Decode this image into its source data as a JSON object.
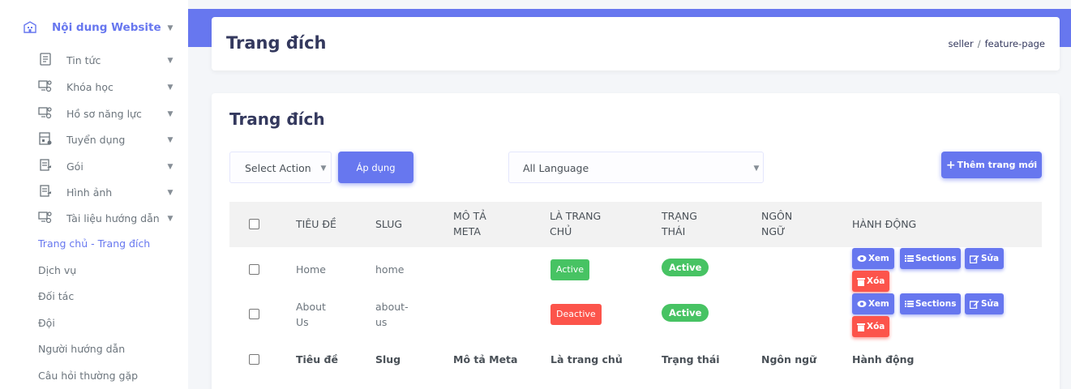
{
  "colors": {
    "primary": "#6777ef",
    "success": "#47c363",
    "danger": "#fc544b"
  },
  "sidebar": {
    "top": {
      "label": "Nội dung Website",
      "icon": "building-icon"
    },
    "items": [
      {
        "label": "Tin tức",
        "icon": "document-icon"
      },
      {
        "label": "Khóa học",
        "icon": "network-icon"
      },
      {
        "label": "Hồ sơ năng lực",
        "icon": "network-icon"
      },
      {
        "label": "Tuyển dụng",
        "icon": "store-icon"
      },
      {
        "label": "Gói",
        "icon": "clipboard-icon"
      },
      {
        "label": "Hình ảnh",
        "icon": "clipboard-icon"
      },
      {
        "label": "Tài liệu hướng dẫn",
        "icon": "network-icon"
      }
    ],
    "links": [
      {
        "label": "Trang chủ - Trang đích",
        "active": true
      },
      {
        "label": "Dịch vụ"
      },
      {
        "label": "Đối tác"
      },
      {
        "label": "Đội"
      },
      {
        "label": "Người hướng dẫn"
      },
      {
        "label": "Câu hỏi thường gặp"
      }
    ]
  },
  "header": {
    "title": "Trang đích",
    "breadcrumb": [
      "seller",
      "feature-page"
    ]
  },
  "main": {
    "title": "Trang đích",
    "select_action": "Select Action",
    "apply_label": "Áp dụng",
    "language": "All Language",
    "add_label": "Thêm trang mới",
    "columns": {
      "title": "Tiêu đề",
      "slug": "Slug",
      "meta_1": "Mô tả",
      "meta_2": "meta",
      "home_1": "Là trang",
      "home_2": "chủ",
      "status_1": "Trạng",
      "status_2": "thái",
      "lang_1": "Ngôn",
      "lang_2": "ngữ",
      "actions": "Hành động"
    },
    "rows": [
      {
        "title": "Home",
        "slug": "home",
        "home_badge": "Active",
        "status_badge": "Active"
      },
      {
        "title_1": "About",
        "title_2": "Us",
        "slug_1": "about-",
        "slug_2": "us",
        "home_badge": "Deactive",
        "status_badge": "Active"
      }
    ],
    "actions": {
      "view": "Xem",
      "sections": "Sections",
      "edit": "Sửa",
      "delete": "Xóa"
    },
    "footer": {
      "title": "Tiêu đề",
      "slug": "Slug",
      "meta": "Mô tả Meta",
      "home": "Là trang chủ",
      "status": "Trạng thái",
      "lang": "Ngôn ngữ",
      "actions": "Hành động"
    }
  }
}
